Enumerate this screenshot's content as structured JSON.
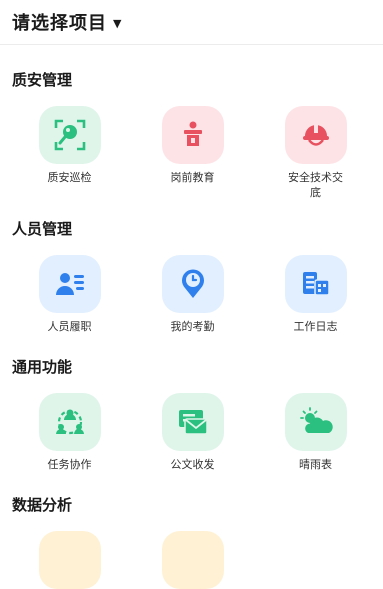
{
  "header": {
    "title": "请选择项目"
  },
  "sections": [
    {
      "title": "质安管理",
      "items": [
        {
          "label": "质安巡检"
        },
        {
          "label": "岗前教育"
        },
        {
          "label": "安全技术交底"
        }
      ]
    },
    {
      "title": "人员管理",
      "items": [
        {
          "label": "人员履职"
        },
        {
          "label": "我的考勤"
        },
        {
          "label": "工作日志"
        }
      ]
    },
    {
      "title": "通用功能",
      "items": [
        {
          "label": "任务协作"
        },
        {
          "label": "公文收发"
        },
        {
          "label": "晴雨表"
        }
      ]
    },
    {
      "title": "数据分析"
    }
  ],
  "colors": {
    "green": "#2bc07f",
    "pink": "#e8515f",
    "blue": "#2f80ed",
    "yellow": "#f5c24a"
  },
  "icons": [
    "search-scan-icon",
    "podium-icon",
    "safety-helmet-icon",
    "person-info-icon",
    "clock-pin-icon",
    "log-report-icon",
    "team-collab-icon",
    "mail-doc-icon",
    "sun-cloud-icon"
  ]
}
